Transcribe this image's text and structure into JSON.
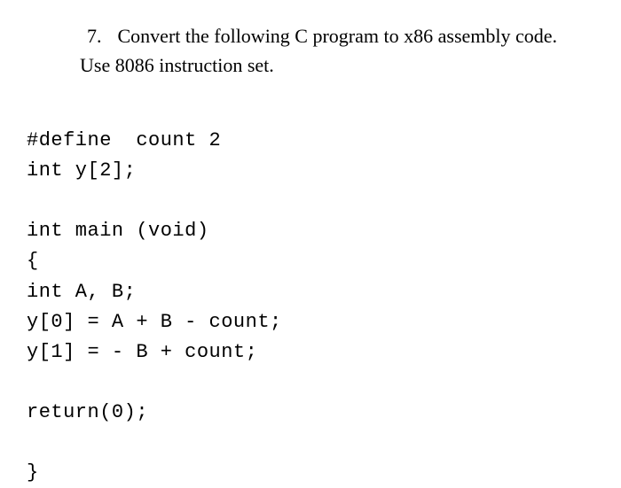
{
  "question": {
    "number": "7.",
    "line1": "Convert the following C program to x86 assembly code.",
    "line2": "Use 8086 instruction set."
  },
  "code": {
    "l1": "#define  count 2",
    "l2": "int y[2];",
    "l3": "",
    "l4": "int main (void)",
    "l5": "{",
    "l6": "int A, B;",
    "l7": "y[0] = A + B - count;",
    "l8": "y[1] = - B + count;",
    "l9": "",
    "l10": "return(0);",
    "l11": "",
    "l12": "}"
  }
}
